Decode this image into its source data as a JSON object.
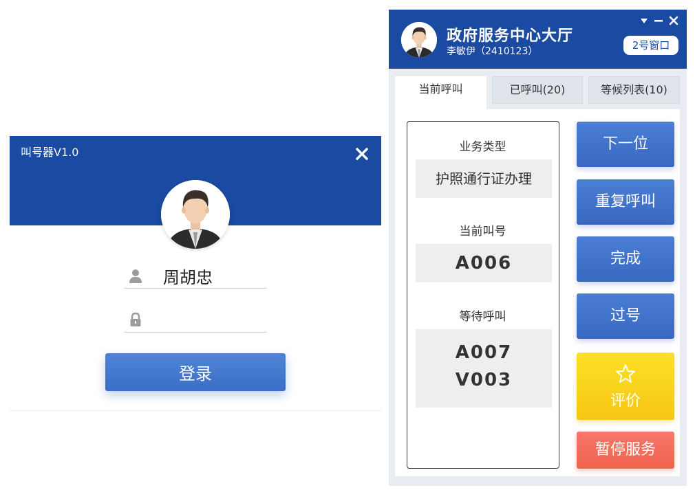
{
  "login": {
    "title": "叫号器V1.0",
    "username": "周胡忠",
    "password": "",
    "login_button": "登录",
    "icons": {
      "close": "close-icon",
      "user": "user-icon",
      "lock": "lock-icon"
    }
  },
  "panel": {
    "org_name": "政府服务中心大厅",
    "user": "李敏伊（2410123）",
    "window_badge": "2号窗口",
    "controls": [
      "chevron-down-icon",
      "minimize-icon",
      "close-icon"
    ],
    "tabs": [
      {
        "label": "当前呼叫",
        "active": true
      },
      {
        "label": "已呼叫(20)",
        "active": false
      },
      {
        "label": "等候列表(10)",
        "active": false
      }
    ],
    "info": {
      "business_type_label": "业务类型",
      "business_type_value": "护照通行证办理",
      "current_number_label": "当前叫号",
      "current_number_value": "A006",
      "waiting_label": "等待呼叫",
      "waiting_values": [
        "A007",
        "V003"
      ]
    },
    "actions": {
      "next": "下一位",
      "recall": "重复呼叫",
      "complete": "完成",
      "skip": "过号",
      "rate": "评价",
      "pause": "暂停服务"
    }
  },
  "colors": {
    "brand_blue": "#1a4aa1",
    "button_blue": "#3f74cc",
    "rate_yellow": "#f9d51d",
    "pause_red": "#f36b58"
  }
}
